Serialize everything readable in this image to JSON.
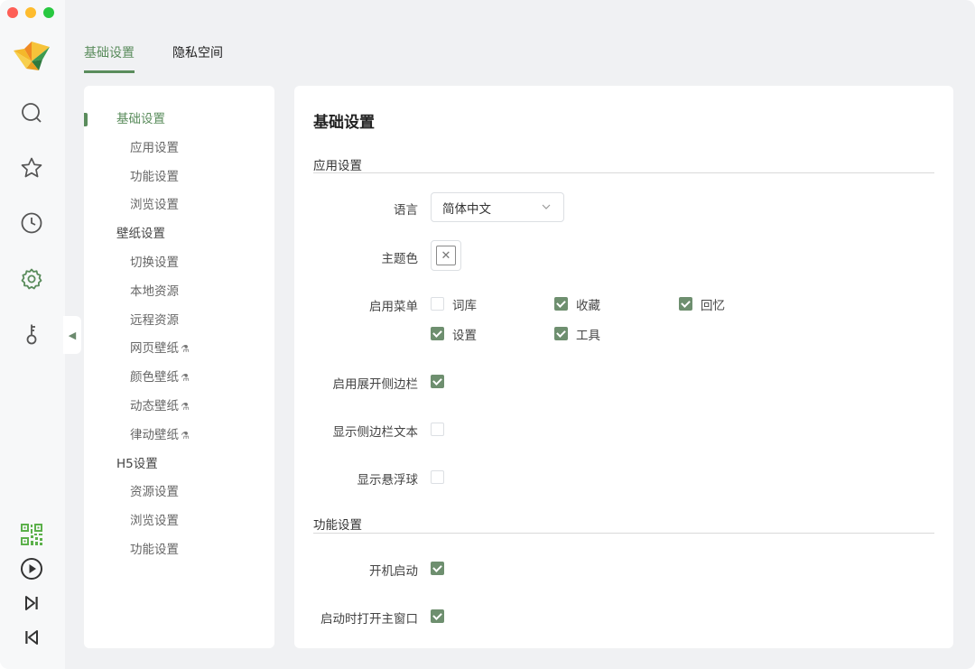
{
  "tabs": [
    {
      "label": "基础设置",
      "active": true
    },
    {
      "label": "隐私空间",
      "active": false
    }
  ],
  "nav": [
    {
      "label": "基础设置",
      "level": "group",
      "active": true
    },
    {
      "label": "应用设置",
      "level": "sub"
    },
    {
      "label": "功能设置",
      "level": "sub"
    },
    {
      "label": "浏览设置",
      "level": "sub"
    },
    {
      "label": "壁纸设置",
      "level": "group"
    },
    {
      "label": "切换设置",
      "level": "sub"
    },
    {
      "label": "本地资源",
      "level": "sub"
    },
    {
      "label": "远程资源",
      "level": "sub"
    },
    {
      "label": "网页壁纸",
      "level": "sub",
      "flask": true
    },
    {
      "label": "颜色壁纸",
      "level": "sub",
      "flask": true
    },
    {
      "label": "动态壁纸",
      "level": "sub",
      "flask": true
    },
    {
      "label": "律动壁纸",
      "level": "sub",
      "flask": true
    },
    {
      "label": "H5设置",
      "level": "group"
    },
    {
      "label": "资源设置",
      "level": "sub"
    },
    {
      "label": "浏览设置",
      "level": "sub"
    },
    {
      "label": "功能设置",
      "level": "sub"
    }
  ],
  "main": {
    "title": "基础设置",
    "section_app": "应用设置",
    "language_label": "语言",
    "language_value": "简体中文",
    "theme_label": "主题色",
    "menu_label": "启用菜单",
    "menu_items": [
      {
        "label": "词库",
        "checked": false
      },
      {
        "label": "收藏",
        "checked": true
      },
      {
        "label": "回忆",
        "checked": true
      },
      {
        "label": "设置",
        "checked": true
      },
      {
        "label": "工具",
        "checked": true
      }
    ],
    "expand_sidebar_label": "启用展开侧边栏",
    "expand_sidebar_checked": true,
    "sidebar_text_label": "显示侧边栏文本",
    "sidebar_text_checked": false,
    "float_ball_label": "显示悬浮球",
    "float_ball_checked": false,
    "section_func": "功能设置",
    "autostart_label": "开机启动",
    "autostart_checked": true,
    "open_main_label": "启动时打开主窗口",
    "open_main_checked": true
  },
  "colors": {
    "accent": "#5a8c5c",
    "checkbox": "#6e8f6f",
    "qr": "#5bb04a"
  },
  "rail_icons": [
    "search-icon",
    "star-icon",
    "clock-icon",
    "gear-icon",
    "key-icon",
    "qrcode-icon",
    "play-icon",
    "skip-next-icon",
    "skip-previous-icon"
  ]
}
